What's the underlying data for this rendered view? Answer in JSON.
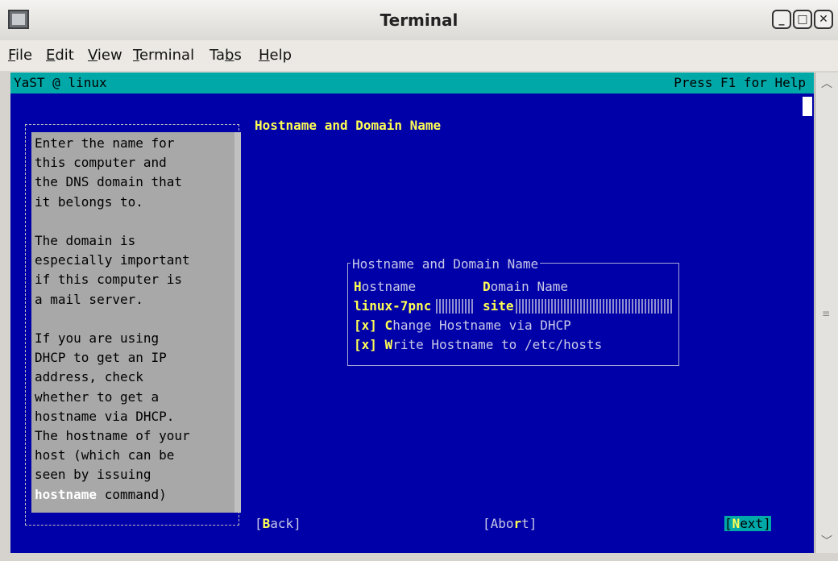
{
  "window": {
    "title": "Terminal"
  },
  "menu": [
    {
      "pre": "",
      "u": "F",
      "post": "ile"
    },
    {
      "pre": "",
      "u": "E",
      "post": "dit"
    },
    {
      "pre": "",
      "u": "V",
      "post": "iew"
    },
    {
      "pre": "",
      "u": "T",
      "post": "erminal"
    },
    {
      "pre": "Ta",
      "u": "b",
      "post": "s"
    },
    {
      "pre": "",
      "u": "H",
      "post": "elp"
    }
  ],
  "status": {
    "left": "YaST @ linux",
    "right": "Press F1 for Help"
  },
  "help": {
    "lines": [
      "Enter the name for",
      "this computer and",
      "the DNS domain that",
      "it belongs to.",
      "",
      "The domain is",
      "especially important",
      "if this computer is",
      "a mail server.",
      "",
      "If you are using",
      "DHCP to get an IP",
      "address, check",
      "whether to get a",
      "hostname via DHCP.",
      "The hostname of your",
      "host (which can be",
      "seen by issuing"
    ],
    "last_cmd": "hostname",
    "last_rest": " command)"
  },
  "dialog": {
    "title": "Hostname and Domain Name",
    "frame_title": "Hostname and Domain Name",
    "hostname_label_hot": "H",
    "hostname_label_rest": "ostname",
    "domain_label_hot": "D",
    "domain_label_rest": "omain Name",
    "hostname_value": "linux-7pnc",
    "domain_value": "site",
    "dhcp_mark": "[x]",
    "dhcp_hot": "C",
    "dhcp_rest": "hange Hostname via DHCP",
    "hosts_mark": "[x]",
    "hosts_hot": "W",
    "hosts_rest": "rite Hostname to /etc/hosts"
  },
  "buttons": {
    "back_pre": "[",
    "back_hot": "B",
    "back_post": "ack]",
    "abort_pre": "[Abo",
    "abort_hot": "r",
    "abort_post": "t]",
    "next_pre": "[",
    "next_hot": "N",
    "next_post": "ext]"
  }
}
